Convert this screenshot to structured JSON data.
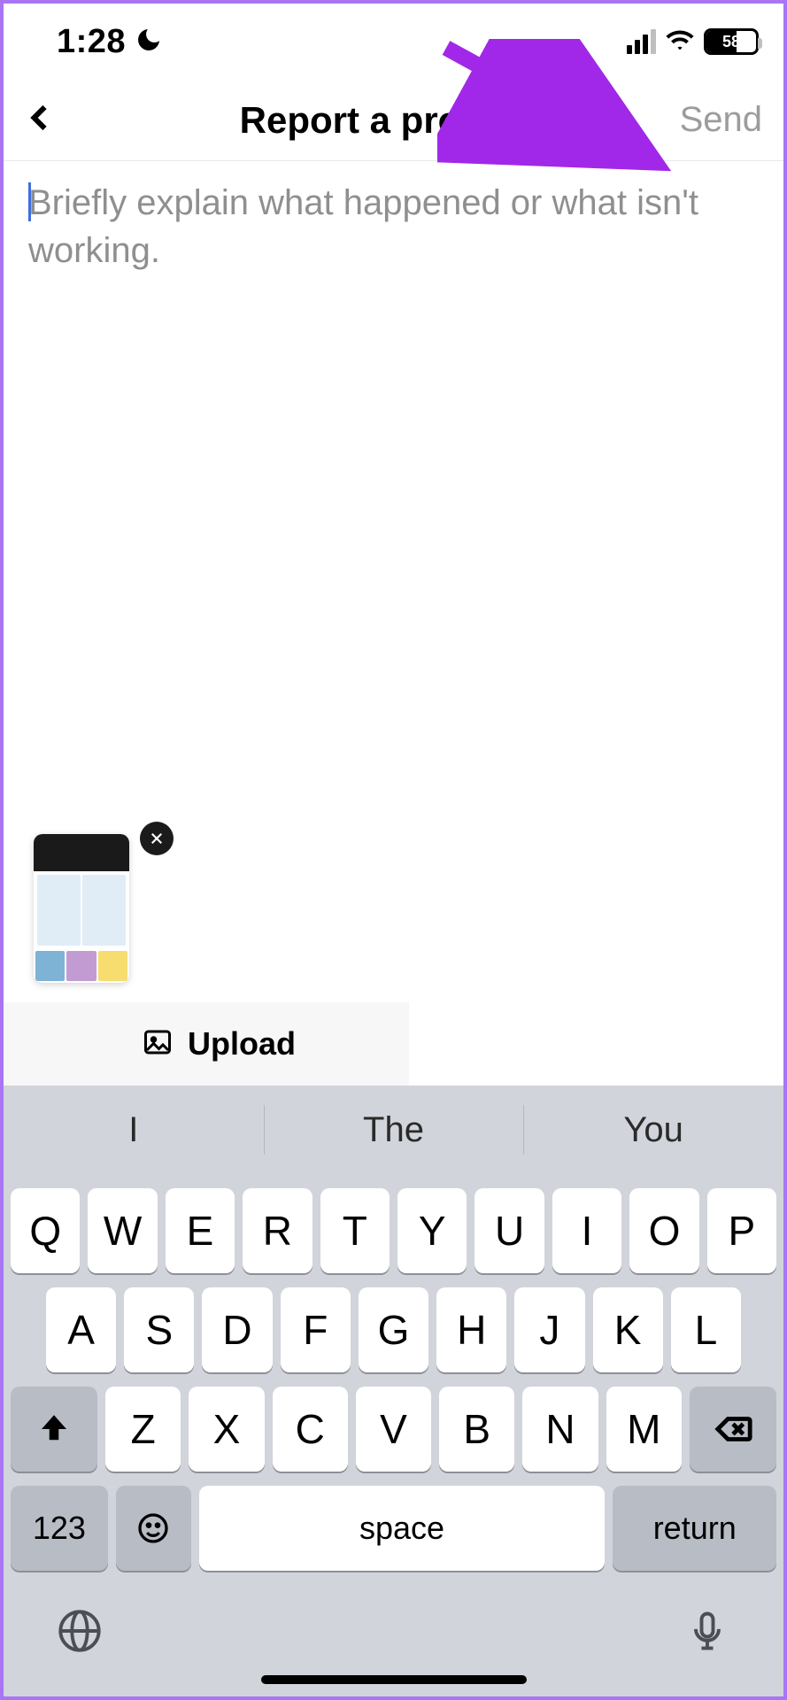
{
  "status": {
    "time": "1:28",
    "battery_pct": "58"
  },
  "nav": {
    "title": "Report a problem",
    "send": "Send"
  },
  "form": {
    "placeholder": "Briefly explain what happened or what isn't working."
  },
  "upload": {
    "label": "Upload"
  },
  "keyboard": {
    "suggestions": [
      "I",
      "The",
      "You"
    ],
    "row1": [
      "Q",
      "W",
      "E",
      "R",
      "T",
      "Y",
      "U",
      "I",
      "O",
      "P"
    ],
    "row2": [
      "A",
      "S",
      "D",
      "F",
      "G",
      "H",
      "J",
      "K",
      "L"
    ],
    "row3": [
      "Z",
      "X",
      "C",
      "V",
      "B",
      "N",
      "M"
    ],
    "numkey": "123",
    "space": "space",
    "return": "return"
  }
}
